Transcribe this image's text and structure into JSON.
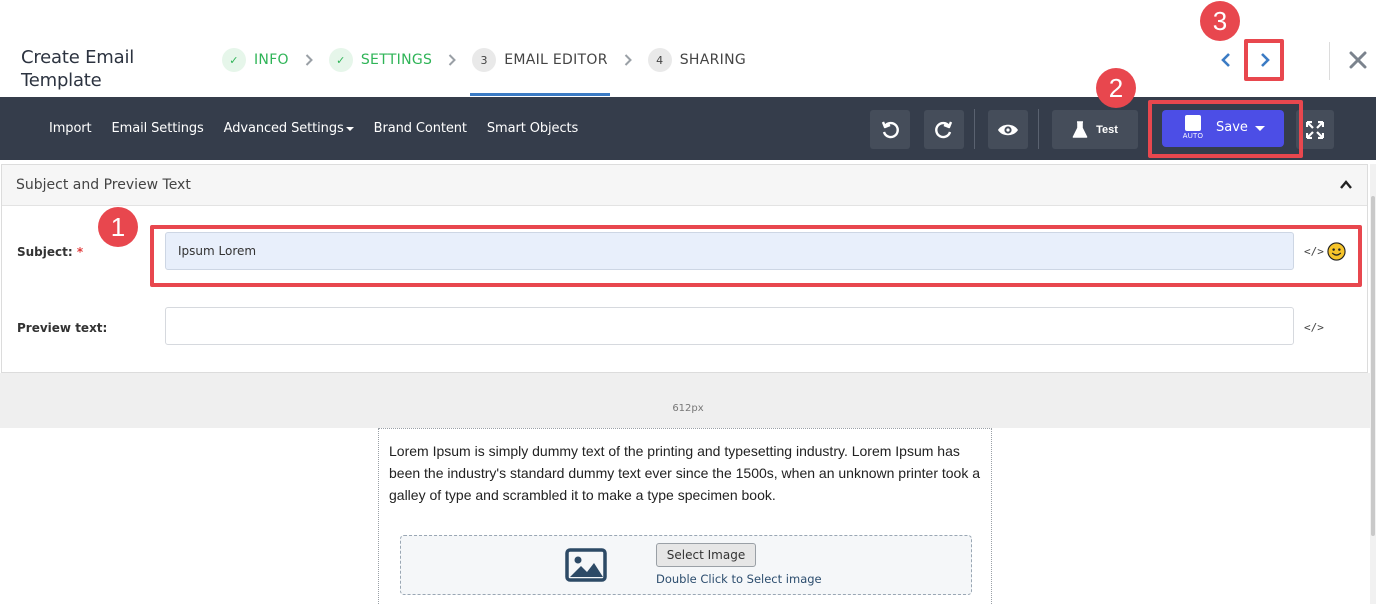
{
  "header": {
    "title": "Create Email Template",
    "steps": [
      {
        "label": "INFO",
        "badge": "✓",
        "state": "done"
      },
      {
        "label": "SETTINGS",
        "badge": "✓",
        "state": "done"
      },
      {
        "label": "EMAIL EDITOR",
        "badge": "3",
        "state": "active"
      },
      {
        "label": "SHARING",
        "badge": "4",
        "state": "todo"
      }
    ]
  },
  "toolbar": {
    "menu": [
      "Import",
      "Email Settings",
      "Advanced Settings",
      "Brand Content",
      "Smart Objects"
    ],
    "test_label": "Test",
    "save_label": "Save",
    "auto_label": "AUTO"
  },
  "subject_panel": {
    "title": "Subject and Preview Text",
    "subject_label": "Subject:",
    "required_mark": "*",
    "subject_value": "Ipsum Lorem",
    "preview_label": "Preview text:",
    "preview_value": "",
    "code_glyph": "</>"
  },
  "canvas": {
    "width_label": "612px"
  },
  "email": {
    "body_text": "Lorem Ipsum is simply dummy text of the printing and typesetting industry. Lorem Ipsum has been the industry's standard dummy text ever since the 1500s, when an unknown printer took a galley of type and scrambled it to make a type specimen book.",
    "select_image_label": "Select Image",
    "double_click_hint": "Double Click to Select image"
  },
  "annotations": [
    "1",
    "2",
    "3"
  ],
  "colors": {
    "accent": "#3b7bc4",
    "done": "#2fb457",
    "toolbar": "#353d4b",
    "save": "#4c4ee6",
    "annotation": "#e8474e"
  }
}
